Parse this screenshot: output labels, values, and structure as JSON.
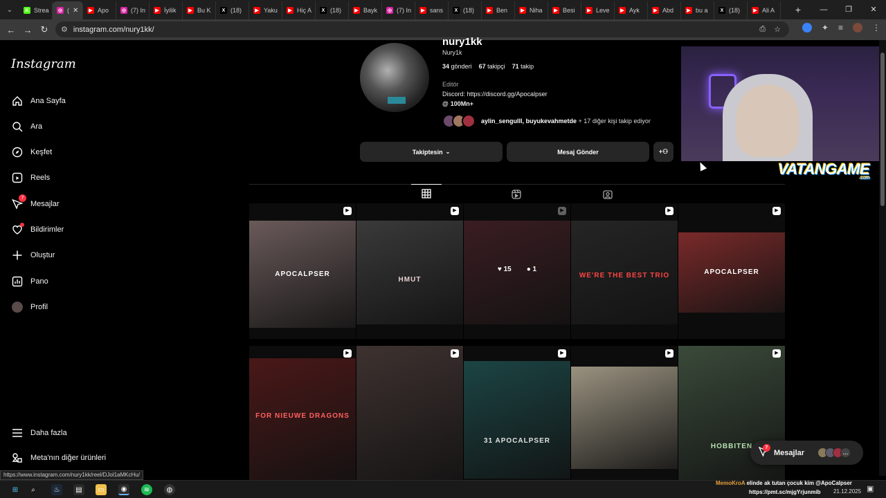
{
  "browser": {
    "tabs": [
      {
        "label": "Strea",
        "favicon_color": "#53fc18",
        "favicon": "K"
      },
      {
        "label": "(",
        "favicon_color": "#d6249f",
        "favicon": "◎",
        "active": true
      },
      {
        "label": "Apo",
        "favicon_color": "#ff0000",
        "favicon": "▶"
      },
      {
        "label": "(7) In",
        "favicon_color": "#d6249f",
        "favicon": "◎"
      },
      {
        "label": "İyilik",
        "favicon_color": "#ff0000",
        "favicon": "▶"
      },
      {
        "label": "Bu K",
        "favicon_color": "#ff0000",
        "favicon": "▶"
      },
      {
        "label": "(18)",
        "favicon_color": "#000000",
        "favicon": "X"
      },
      {
        "label": "Yaku",
        "favicon_color": "#ff0000",
        "favicon": "▶"
      },
      {
        "label": "Hiç A",
        "favicon_color": "#ff0000",
        "favicon": "▶"
      },
      {
        "label": "(18)",
        "favicon_color": "#000000",
        "favicon": "X"
      },
      {
        "label": "Bayk",
        "favicon_color": "#ff0000",
        "favicon": "▶"
      },
      {
        "label": "(7) In",
        "favicon_color": "#d6249f",
        "favicon": "◎"
      },
      {
        "label": "sans",
        "favicon_color": "#ff0000",
        "favicon": "▶"
      },
      {
        "label": "(18)",
        "favicon_color": "#000000",
        "favicon": "X"
      },
      {
        "label": "Ben",
        "favicon_color": "#ff0000",
        "favicon": "▶"
      },
      {
        "label": "Niha",
        "favicon_color": "#ff0000",
        "favicon": "▶"
      },
      {
        "label": "Besi",
        "favicon_color": "#ff0000",
        "favicon": "▶"
      },
      {
        "label": "Leve",
        "favicon_color": "#ff0000",
        "favicon": "▶"
      },
      {
        "label": "Ayk",
        "favicon_color": "#ff0000",
        "favicon": "▶"
      },
      {
        "label": "Abd",
        "favicon_color": "#ff0000",
        "favicon": "▶"
      },
      {
        "label": "bu a",
        "favicon_color": "#ff0000",
        "favicon": "▶"
      },
      {
        "label": "(18)",
        "favicon_color": "#000000",
        "favicon": "X"
      },
      {
        "label": "Ali A",
        "favicon_color": "#ff0000",
        "favicon": "▶"
      }
    ],
    "url": "instagram.com/nury1kk/",
    "status_url": "https://www.instagram.com/nury1kk/reel/DJol1aMKcHu/"
  },
  "sidebar": {
    "logo": "Instagram",
    "items": [
      {
        "label": "Ana Sayfa",
        "icon": "home-icon"
      },
      {
        "label": "Ara",
        "icon": "search-icon"
      },
      {
        "label": "Keşfet",
        "icon": "compass-icon"
      },
      {
        "label": "Reels",
        "icon": "reels-icon"
      },
      {
        "label": "Mesajlar",
        "icon": "messenger-icon",
        "badge": "7"
      },
      {
        "label": "Bildirimler",
        "icon": "heart-icon",
        "dot": true
      },
      {
        "label": "Oluştur",
        "icon": "plus-icon"
      },
      {
        "label": "Pano",
        "icon": "dashboard-icon"
      },
      {
        "label": "Profil",
        "icon": "avatar-icon"
      }
    ],
    "more": "Daha fazla",
    "meta": "Meta'nın diğer ürünleri"
  },
  "profile": {
    "handle": "nury1kk",
    "full_name": "Nury1k",
    "posts": "34",
    "posts_label": "gönderi",
    "followers": "67",
    "followers_label": "takipçi",
    "following": "71",
    "following_label": "takip",
    "category": "Editör",
    "bio": "Discord: https://discord.gg/Apocalpser",
    "threads": "100Mn+",
    "followed_by_users": "aylin_sengulll, buyukevahmetde",
    "followed_by_rest": " + 17 diğer kişi takip ediyor",
    "follow_button": "Takiptesin",
    "message_button": "Mesaj Gönder"
  },
  "grid_posts": [
    {
      "text": "APOCALPSER",
      "bg": "#6a5a5a"
    },
    {
      "text": "HMUT",
      "bg": "#3a3a3a"
    },
    {
      "text": "",
      "bg": "#3a1d22",
      "likes": "15",
      "comments": "1"
    },
    {
      "text": "WE'RE THE BEST TRIO",
      "bg": "#252525"
    },
    {
      "text": "APOCALPSER",
      "bg": "#7a2a2a"
    },
    {
      "text": "FOR NIEUWE DRAGONS",
      "bg": "#4a1818"
    },
    {
      "text": "",
      "bg": "#3e3230"
    },
    {
      "text": "31 APOCALPSER",
      "bg": "#1c4444"
    },
    {
      "text": "",
      "bg": "#9a9280"
    },
    {
      "text": "HOBBITEN",
      "bg": "#3a4a3a"
    }
  ],
  "overlay": {
    "brand": "VATANGAME",
    "brand_sub": ".com",
    "chat_user": "MemoKroA",
    "chat_text": "elinde ak tutan çocuk kim @ApoCalpser",
    "chat_url": "https://pmt.sc/mjgYrjunmib"
  },
  "messages_bubble": {
    "label": "Mesajlar",
    "badge": "7"
  },
  "taskbar": {
    "date": "21.12.2025"
  }
}
